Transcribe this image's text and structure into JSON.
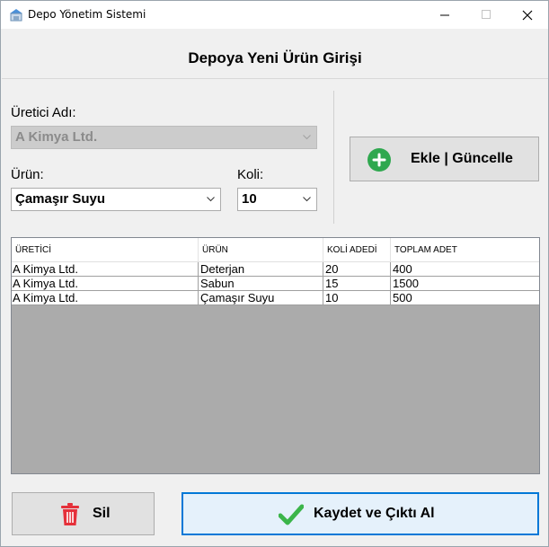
{
  "window": {
    "title": "Depo Yönetim Sistemi",
    "minimize_glyph": "—",
    "maximize_glyph": "☐",
    "close_glyph": "✕"
  },
  "page": {
    "title": "Depoya Yeni Ürün Girişi"
  },
  "form": {
    "producer_label": "Üretici Adı:",
    "producer_value": "A Kimya Ltd.",
    "product_label": "Ürün:",
    "product_value": "Çamaşır Suyu",
    "boxes_label": "Koli:",
    "boxes_value": "10"
  },
  "buttons": {
    "add_update_label": "Ekle | Güncelle",
    "delete_label": "Sil",
    "save_print_label": "Kaydet ve Çıktı Al"
  },
  "table": {
    "columns": [
      "ÜRETİCİ",
      "ÜRÜN",
      "KOLİ ADEDİ",
      "TOPLAM ADET"
    ],
    "rows": [
      [
        "A Kimya Ltd.",
        "Deterjan",
        "20",
        "400"
      ],
      [
        "A Kimya Ltd.",
        "Sabun",
        "15",
        "1500"
      ],
      [
        "A Kimya Ltd.",
        "Çamaşır Suyu",
        "10",
        "500"
      ]
    ]
  },
  "colors": {
    "add_icon": "#2fa84f",
    "delete_icon": "#e5303a",
    "check_icon": "#3bb54a",
    "focus_border": "#0078d7"
  }
}
